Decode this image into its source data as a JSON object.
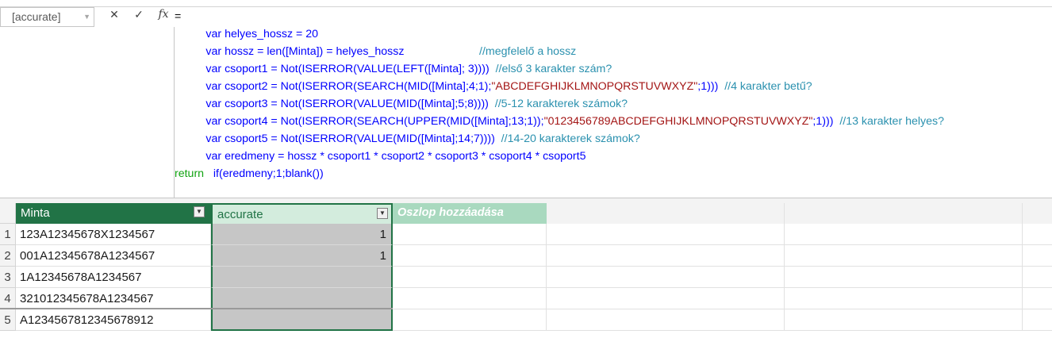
{
  "formula_bar": {
    "name_box": "[accurate]",
    "cancel_icon": "✕",
    "enter_icon": "✓",
    "fx_label": "fx",
    "lines": [
      [
        {
          "t": "=",
          "c": "br"
        }
      ],
      [
        {
          "t": "          "
        },
        {
          "t": "var",
          "c": "kw"
        },
        {
          "t": " helyes_hossz = 20",
          "c": "kw"
        }
      ],
      [
        {
          "t": "          "
        },
        {
          "t": "var hossz = ",
          "c": "kw"
        },
        {
          "t": "len",
          "c": "fn"
        },
        {
          "t": "([Minta]) = helyes_hossz",
          "c": "kw"
        },
        {
          "t": "                        //megfelelő a hossz",
          "c": "cm"
        }
      ],
      [
        {
          "t": "          "
        },
        {
          "t": "var csoport1 = ",
          "c": "kw"
        },
        {
          "t": "Not(ISERROR(VALUE(LEFT([Minta]; 3))))",
          "c": "fn"
        },
        {
          "t": "  //első 3 karakter szám?",
          "c": "cm"
        }
      ],
      [
        {
          "t": "          "
        },
        {
          "t": "var csoport2 = ",
          "c": "kw"
        },
        {
          "t": "Not(ISERROR(SEARCH(MID([Minta];4;1);",
          "c": "fn"
        },
        {
          "t": "\"ABCDEFGHIJKLMNOPQRSTUVWXYZ\"",
          "c": "str"
        },
        {
          "t": ";1)))",
          "c": "fn"
        },
        {
          "t": "  //4 karakter betű?",
          "c": "cm"
        }
      ],
      [
        {
          "t": "          "
        },
        {
          "t": "var csoport3 = ",
          "c": "kw"
        },
        {
          "t": "Not(ISERROR(VALUE(MID([Minta];5;8))))",
          "c": "fn"
        },
        {
          "t": "  //5-12 karakterek számok?",
          "c": "cm"
        }
      ],
      [
        {
          "t": "          "
        },
        {
          "t": "var csoport4 = ",
          "c": "kw"
        },
        {
          "t": "Not(ISERROR(SEARCH(UPPER(MID([Minta];13;1));",
          "c": "fn"
        },
        {
          "t": "\"0123456789ABCDEFGHIJKLMNOPQRSTUVWXYZ\"",
          "c": "str"
        },
        {
          "t": ";1)))",
          "c": "fn"
        },
        {
          "t": "  //13 karakter helyes?",
          "c": "cm"
        }
      ],
      [
        {
          "t": "          "
        },
        {
          "t": "var csoport5 = ",
          "c": "kw"
        },
        {
          "t": "Not(ISERROR(VALUE(MID([Minta];14;7))))",
          "c": "fn"
        },
        {
          "t": "  //14-20 karakterek számok?",
          "c": "cm"
        }
      ],
      [
        {
          "t": "          "
        },
        {
          "t": "var eredmeny = hossz * csoport1 * csoport2 * csoport3 * csoport4 * csoport5",
          "c": "kw"
        }
      ],
      [
        {
          "t": "return",
          "c": "kw2"
        },
        {
          "t": "   "
        },
        {
          "t": "if(eredmeny;1;blank())",
          "c": "fn"
        }
      ]
    ]
  },
  "table": {
    "headers": {
      "minta": "Minta",
      "accurate": "accurate",
      "add_column": "Oszlop hozzáadása"
    },
    "rows": [
      {
        "num": "1",
        "minta": "123A12345678X1234567",
        "accurate": "1"
      },
      {
        "num": "2",
        "minta": "001A12345678A1234567",
        "accurate": "1"
      },
      {
        "num": "3",
        "minta": "1A12345678A1234567",
        "accurate": ""
      },
      {
        "num": "4",
        "minta": "321012345678A1234567",
        "accurate": ""
      },
      {
        "num": "5",
        "minta": "A1234567812345678912",
        "accurate": ""
      }
    ]
  },
  "colors": {
    "accent": "#217346",
    "selected_column": "#c6c6c6"
  }
}
